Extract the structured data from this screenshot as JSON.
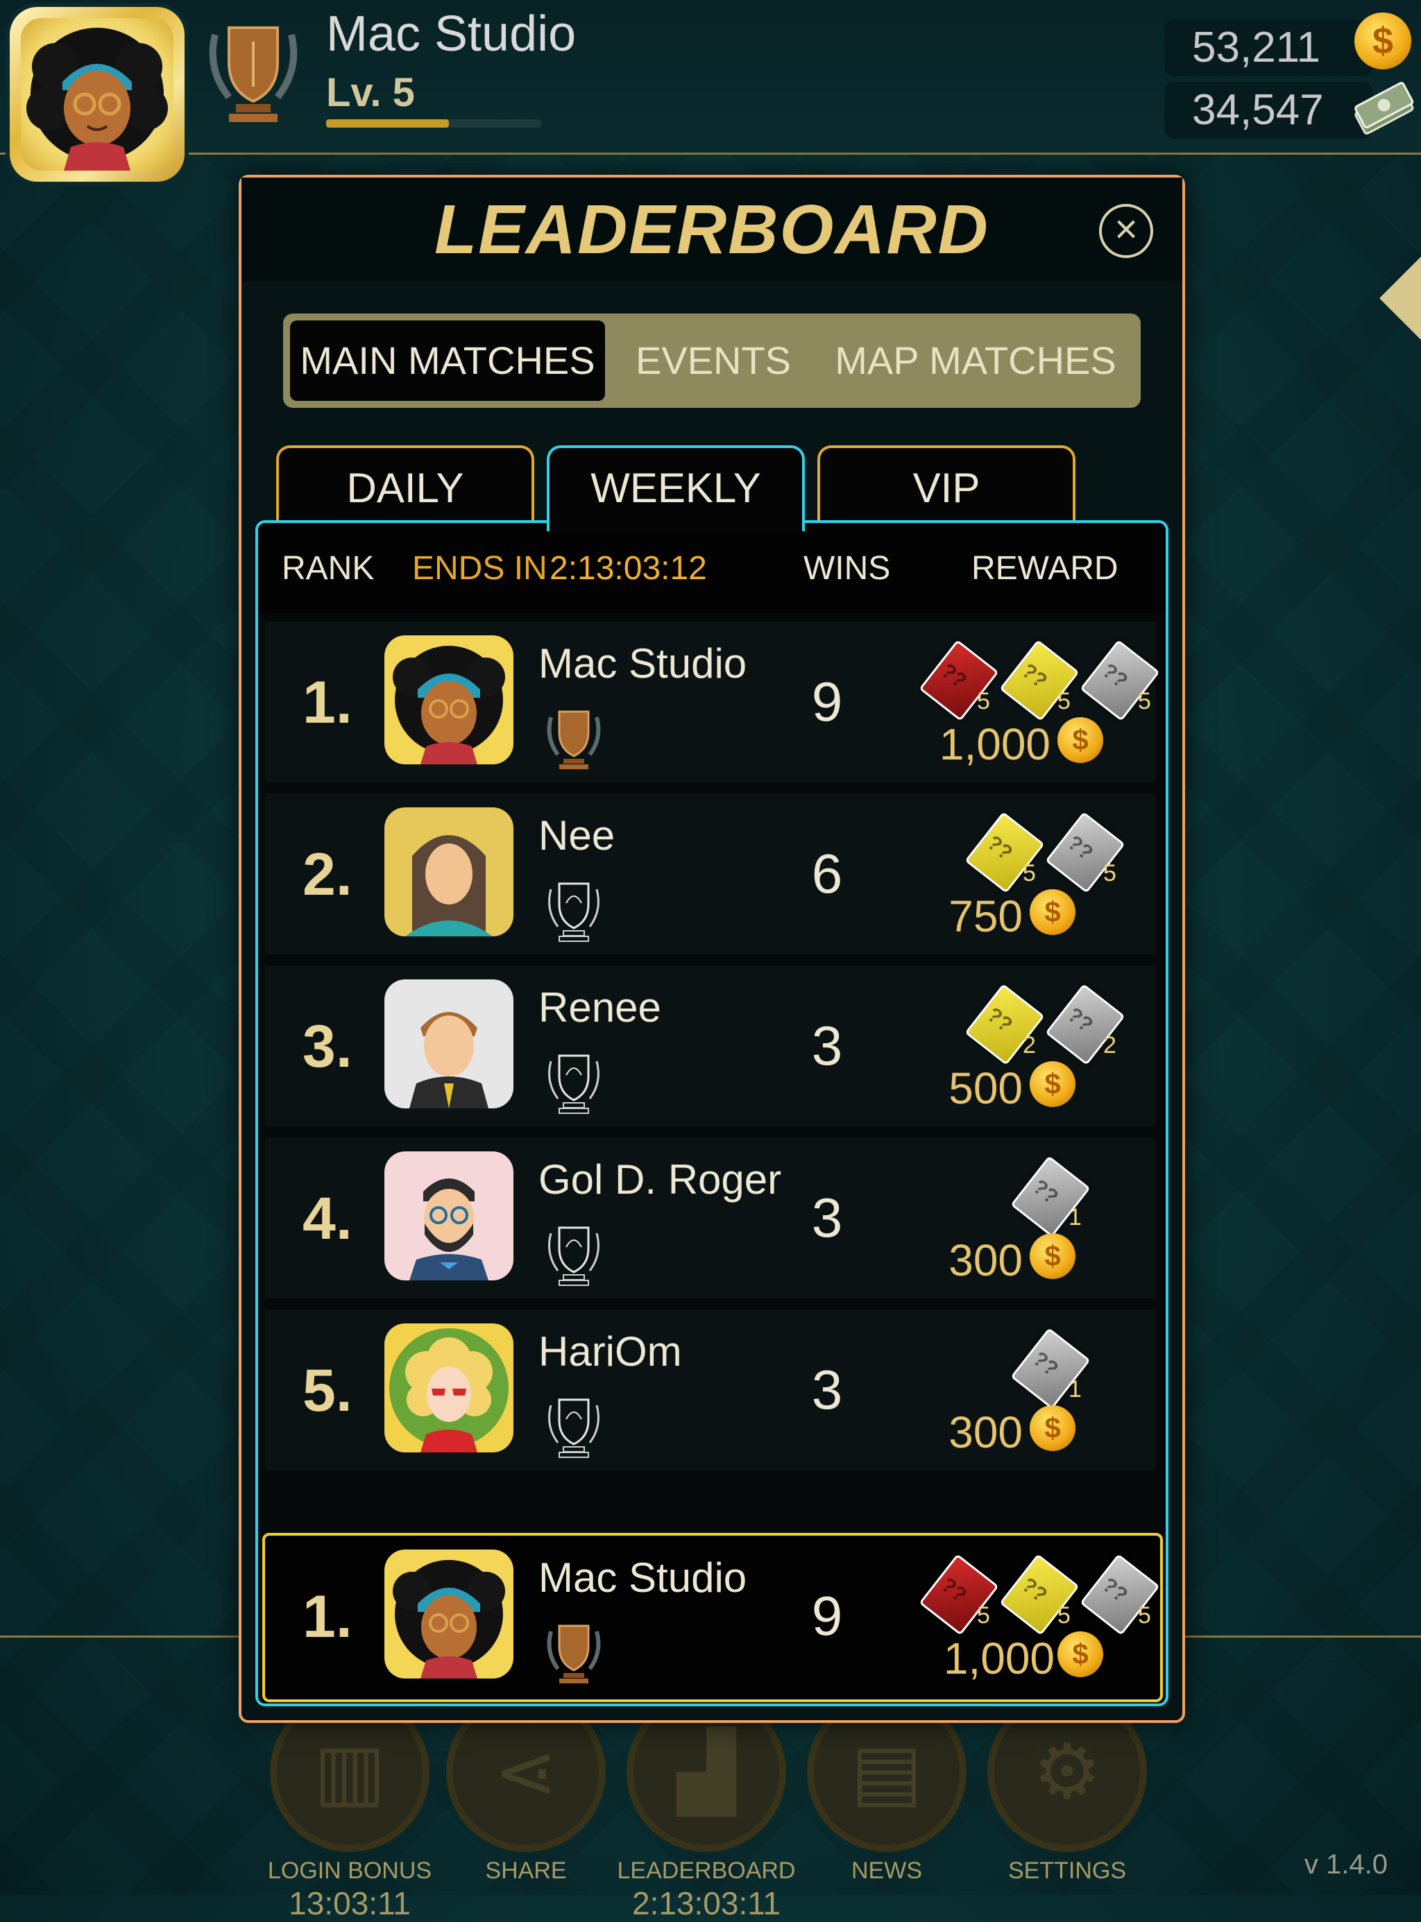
{
  "topbar": {
    "player_name": "Mac Studio",
    "level": "Lv. 5",
    "level_progress": 0.57,
    "coins": "53,211",
    "cash": "34,547"
  },
  "modal": {
    "title": "LEADERBOARD",
    "segments": [
      "MAIN MATCHES",
      "EVENTS",
      "MAP MATCHES"
    ],
    "active_segment": "MAIN MATCHES",
    "tabs": [
      "DAILY",
      "WEEKLY",
      "VIP"
    ],
    "active_tab": "WEEKLY",
    "headers": {
      "rank": "RANK",
      "ends_label": "ENDS IN",
      "ends_time": "2:13:03:12",
      "wins": "WINS",
      "reward": "REWARD"
    },
    "rows": [
      {
        "rank": "1.",
        "name": "Mac Studio",
        "wins": "9",
        "tickets": [
          {
            "color": "red",
            "count": "5"
          },
          {
            "color": "yellow",
            "count": "5"
          },
          {
            "color": "silver",
            "count": "5"
          }
        ],
        "coins": "1,000",
        "avatar": "afro-avatar",
        "badge": "bronze-trophy"
      },
      {
        "rank": "2.",
        "name": "Nee",
        "wins": "6",
        "tickets": [
          {
            "color": "yellow",
            "count": "5"
          },
          {
            "color": "silver",
            "count": "5"
          }
        ],
        "coins": "750",
        "avatar": "long-hair-avatar",
        "badge": "empty-trophy"
      },
      {
        "rank": "3.",
        "name": "Renee",
        "wins": "3",
        "tickets": [
          {
            "color": "yellow",
            "count": "2"
          },
          {
            "color": "silver",
            "count": "2"
          }
        ],
        "coins": "500",
        "avatar": "suit-avatar",
        "badge": "empty-trophy"
      },
      {
        "rank": "4.",
        "name": "Gol D. Roger",
        "wins": "3",
        "tickets": [
          {
            "color": "silver",
            "count": "1"
          }
        ],
        "coins": "300",
        "avatar": "beard-avatar",
        "badge": "empty-trophy"
      },
      {
        "rank": "5.",
        "name": "HariOm",
        "wins": "3",
        "tickets": [
          {
            "color": "silver",
            "count": "1"
          }
        ],
        "coins": "300",
        "avatar": "blonde-avatar",
        "badge": "empty-trophy"
      }
    ],
    "self_row": {
      "rank": "1.",
      "name": "Mac Studio",
      "wins": "9",
      "tickets": [
        {
          "color": "red",
          "count": "5"
        },
        {
          "color": "yellow",
          "count": "5"
        },
        {
          "color": "silver",
          "count": "5"
        }
      ],
      "coins": "1,000"
    }
  },
  "nav": [
    {
      "label": "LOGIN BONUS",
      "timer": "13:03:11",
      "icon": "gift-icon"
    },
    {
      "label": "SHARE",
      "timer": "",
      "icon": "share-icon"
    },
    {
      "label": "LEADERBOARD",
      "timer": "2:13:03:11",
      "icon": "leaderboard-icon"
    },
    {
      "label": "NEWS",
      "timer": "",
      "icon": "news-icon"
    },
    {
      "label": "SETTINGS",
      "timer": "",
      "icon": "gear-icon"
    }
  ],
  "version": "v 1.4.0",
  "colors": {
    "accent_gold": "#e5c979",
    "tab_active": "#2fd2e8",
    "self_highlight": "#f2cf23"
  }
}
